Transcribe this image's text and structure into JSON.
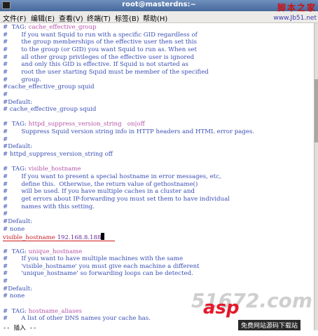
{
  "window": {
    "title": "root@masterdns:~"
  },
  "menu": [
    "文件(F)",
    "编辑(E)",
    "查看(V)",
    "终端(T)",
    "标签(B)",
    "帮助(H)"
  ],
  "watermark_top": {
    "title": "脚本之家",
    "url": "www.Jb51.net"
  },
  "editor_lines": [
    "#  TAG: cache_effective_group",
    "#       If you want Squid to run with a specific GID regardless of",
    "#       the group memberships of the effective user then set this",
    "#       to the group (or GID) you want Squid to run as. When set",
    "#       all other group privileges of the effective user is ignored",
    "#       and only this GID is effective. If Squid is not started as",
    "#       root the user starting Squid must be member of the specified",
    "#       group.",
    "#cache_effective_group squid",
    "#",
    "#Default:",
    "# cache_effective_group squid",
    "",
    "#  TAG: httpd_suppress_version_string   on|off",
    "#       Suppress Squid version string info in HTTP headers and HTML error pages.",
    "#",
    "#Default:",
    "# httpd_suppress_version_string off",
    "",
    "#  TAG: visible_hostname",
    "#       If you want to present a special hostname in error messages, etc,",
    "#       define this.  Otherwise, the return value of gethostname()",
    "#       will be used. If you have multiple caches in a cluster and",
    "#       get errors about IP-forwarding you must set them to have individual",
    "#       names with this setting.",
    "#",
    "#Default:",
    "# none",
    "visible_hostname 192.168.8.188",
    "",
    "#  TAG: unique_hostname",
    "#       If you want to have multiple machines with the same",
    "#       'visible_hostname' you must give each machine a different",
    "#       'unique_hostname' so forwarding loops can be detected.",
    "#",
    "#Default:",
    "# none",
    "",
    "#  TAG: hostname_aliases",
    "#       A list of other DNS names your cache has."
  ],
  "status_line": "-- 插入 --",
  "watermark_bottom": {
    "brand": "asp",
    "number": "51672.com",
    "slogan": "免费网站源码下载站"
  },
  "colors": {
    "comment": "#3a4fb4",
    "tag": "#b455a8",
    "code": "#6a2a9e",
    "highlight": "#c41e2a",
    "underline": "#cc1a1a"
  }
}
